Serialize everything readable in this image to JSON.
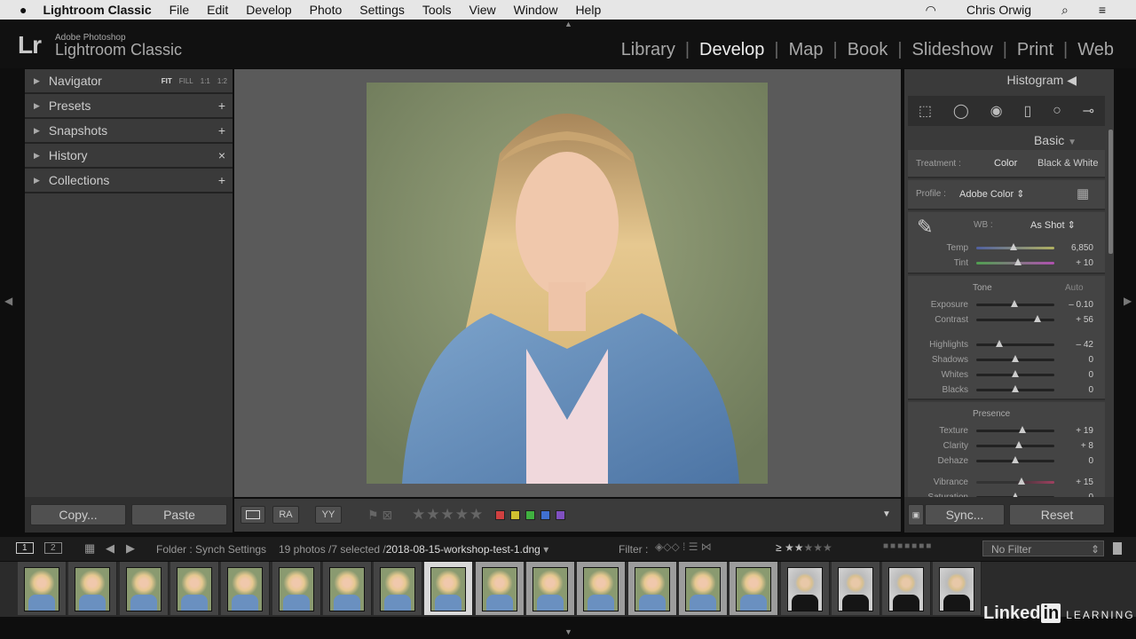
{
  "menubar": {
    "apple": "",
    "app": "Lightroom Classic",
    "items": [
      "File",
      "Edit",
      "Develop",
      "Photo",
      "Settings",
      "Tools",
      "View",
      "Window",
      "Help"
    ],
    "user": "Chris Orwig"
  },
  "brand": {
    "logo": "Lr",
    "line1": "Adobe Photoshop",
    "line2": "Lightroom Classic"
  },
  "modules": [
    {
      "label": "Library"
    },
    {
      "label": "Develop",
      "active": true
    },
    {
      "label": "Map"
    },
    {
      "label": "Book"
    },
    {
      "label": "Slideshow"
    },
    {
      "label": "Print"
    },
    {
      "label": "Web"
    }
  ],
  "left_panel": {
    "navigator": {
      "label": "Navigator",
      "zoom": [
        "FIT",
        "FILL",
        "1:1",
        "1:2"
      ]
    },
    "sections": [
      {
        "label": "Presets",
        "action": "+"
      },
      {
        "label": "Snapshots",
        "action": "+"
      },
      {
        "label": "History",
        "action": "×"
      },
      {
        "label": "Collections",
        "action": "+"
      }
    ],
    "copy": "Copy...",
    "paste": "Paste"
  },
  "right_panel": {
    "histogram": "Histogram",
    "basic": "Basic",
    "treatment_label": "Treatment :",
    "treatment_color": "Color",
    "treatment_bw": "Black & White",
    "profile_label": "Profile :",
    "profile_value": "Adobe Color",
    "wb_label": "WB :",
    "wb_value": "As Shot",
    "tone": "Tone",
    "auto": "Auto",
    "presence": "Presence",
    "sync": "Sync...",
    "reset": "Reset",
    "sliders": {
      "wb": [
        {
          "label": "Temp",
          "value": "6,850",
          "pos": 0.48
        },
        {
          "label": "Tint",
          "value": "+ 10",
          "pos": 0.53
        }
      ],
      "tone1": [
        {
          "label": "Exposure",
          "value": "– 0.10",
          "pos": 0.49
        },
        {
          "label": "Contrast",
          "value": "+ 56",
          "pos": 0.78
        }
      ],
      "tone2": [
        {
          "label": "Highlights",
          "value": "– 42",
          "pos": 0.29
        },
        {
          "label": "Shadows",
          "value": "0",
          "pos": 0.5
        },
        {
          "label": "Whites",
          "value": "0",
          "pos": 0.5
        },
        {
          "label": "Blacks",
          "value": "0",
          "pos": 0.5
        }
      ],
      "presence": [
        {
          "label": "Texture",
          "value": "+ 19",
          "pos": 0.595
        },
        {
          "label": "Clarity",
          "value": "+ 8",
          "pos": 0.54
        },
        {
          "label": "Dehaze",
          "value": "0",
          "pos": 0.5
        }
      ],
      "presence2": [
        {
          "label": "Vibrance",
          "value": "+ 15",
          "pos": 0.575
        },
        {
          "label": "Saturation",
          "value": "0",
          "pos": 0.5
        }
      ]
    }
  },
  "toolbar": {
    "rating_stars": 0,
    "color_labels": [
      "#d04040",
      "#d0c030",
      "#40b040",
      "#4070d0",
      "#8050c0"
    ]
  },
  "filterbar": {
    "view1": "1",
    "view2": "2",
    "source": "Folder : Synch Settings",
    "count": "19 photos /7 selected /",
    "filename": "2018-08-15-workshop-test-1.dng",
    "filter_label": "Filter :",
    "filter_value": "No Filter",
    "rating_op": "≥"
  },
  "filmstrip": {
    "total": 19,
    "selected_range": [
      8,
      14
    ],
    "current": 8
  },
  "watermark": {
    "text": "Linked",
    "in": "in",
    "learning": "LEARNING"
  }
}
